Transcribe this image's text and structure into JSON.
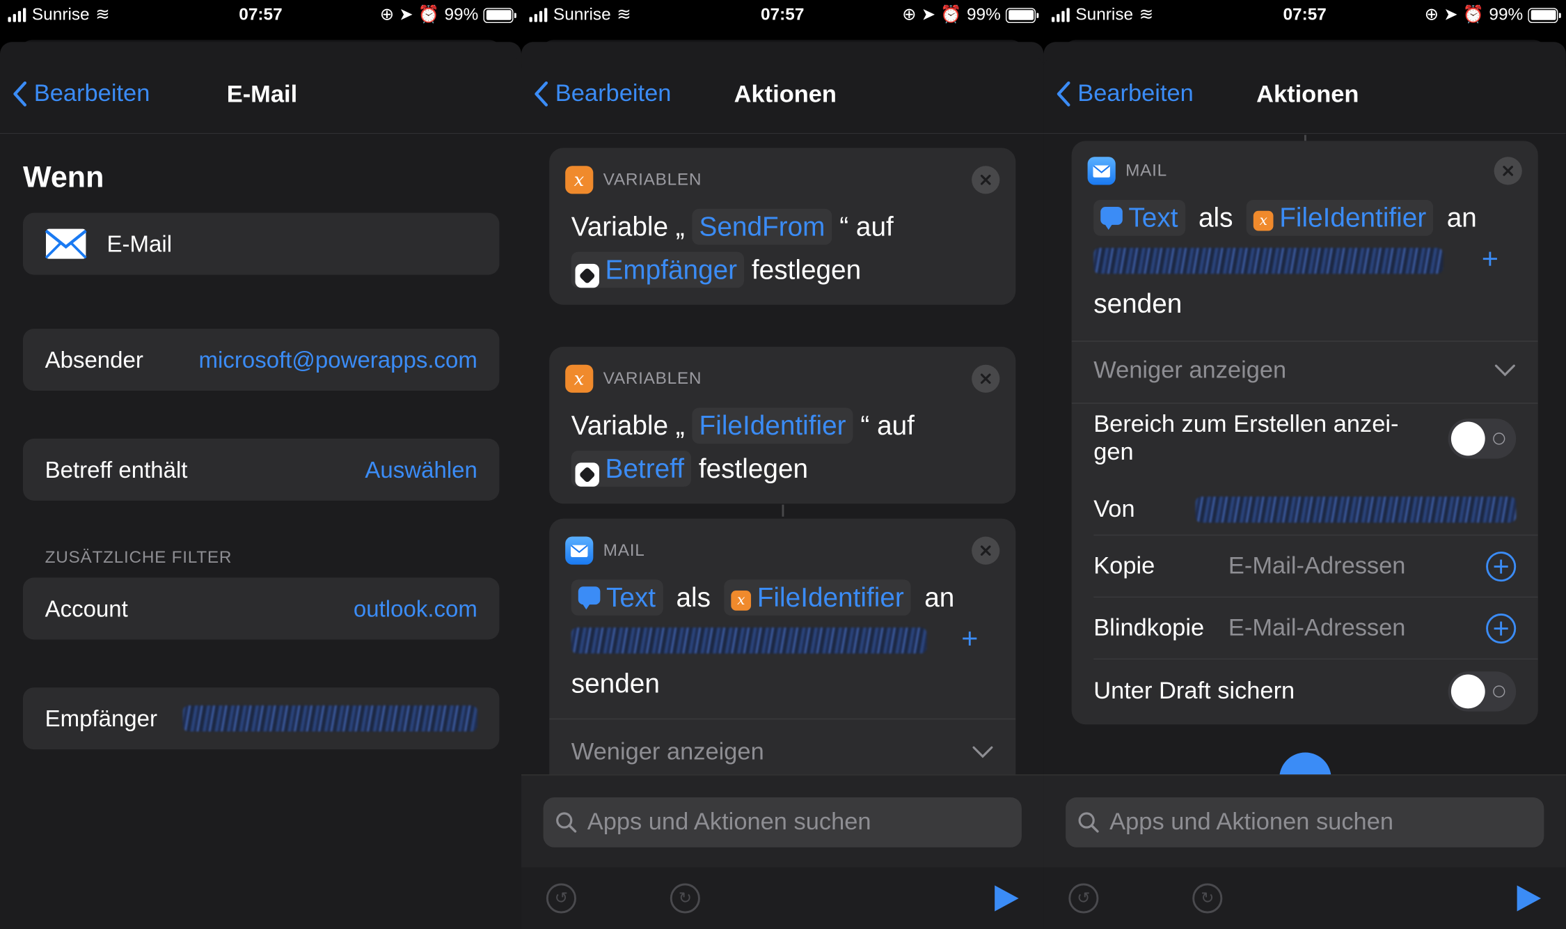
{
  "status": {
    "carrier": "Sunrise",
    "time": "07:57",
    "battery": "99%"
  },
  "nav": {
    "back": "Bearbeiten"
  },
  "panel1": {
    "title": "E-Mail",
    "heading": "Wenn",
    "trigger": "E-Mail",
    "rows": [
      {
        "label": "Absender",
        "value": "microsoft@powerapps.com"
      },
      {
        "label": "Betreff enthält",
        "value": "Auswählen"
      }
    ],
    "section": "ZUSÄTZLICHE FILTER",
    "account": {
      "label": "Account",
      "value": "outlook.com"
    },
    "recipient": {
      "label": "Empfänger"
    }
  },
  "panel2": {
    "title": "Aktionen",
    "card1": {
      "category": "VARIABLEN",
      "w1": "Variable „",
      "var": "SendFrom",
      "w2": "“ auf",
      "token": "Empfänger",
      "w3": "festlegen"
    },
    "card2": {
      "category": "VARIABLEN",
      "w1": "Variable „",
      "var": "FileIdentifier",
      "w2": "“ auf",
      "token": "Betreff",
      "w3": "festlegen"
    },
    "card3": {
      "category": "MAIL",
      "t1": "Text",
      "w1": "als",
      "t2": "FileIdentifier",
      "w2": "an",
      "w3": "senden",
      "less": "Weniger anzeigen"
    },
    "search": "Apps und Aktionen suchen"
  },
  "panel3": {
    "title": "Aktionen",
    "card": {
      "category": "MAIL",
      "t1": "Text",
      "w1": "als",
      "t2": "FileIdentifier",
      "w2": "an",
      "w3": "senden",
      "less": "Weniger anzeigen"
    },
    "options": {
      "compose": "Bereich zum Erstellen anzei-gen",
      "from": "Von",
      "cc": "Kopie",
      "bcc": "Blindkopie",
      "placeholder": "E-Mail-Adressen",
      "draft": "Unter Draft sichern"
    },
    "search": "Apps und Aktionen suchen"
  },
  "colors": {
    "accent": "#3b8cf6",
    "background": "#1c1c1e",
    "card": "#2c2c2e",
    "variable": "#f08a2c"
  }
}
